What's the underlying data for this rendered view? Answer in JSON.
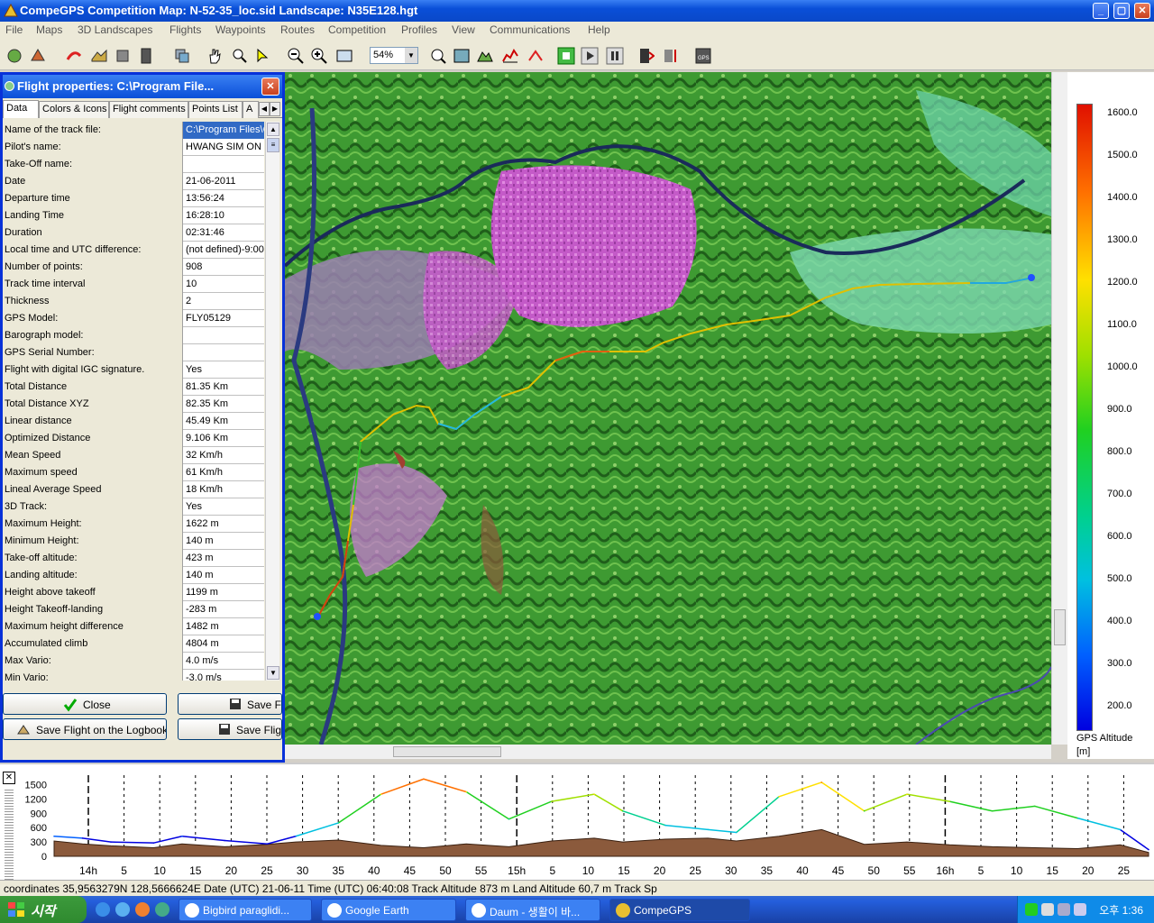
{
  "window": {
    "title": "CompeGPS Competition Map: N-52-35_loc.sid Landscape: N35E128.hgt"
  },
  "menu": [
    "File",
    "Maps",
    "3D Landscapes",
    "Flights",
    "Waypoints",
    "Routes",
    "Competition",
    "Profiles",
    "View",
    "Communications",
    "Help"
  ],
  "toolbar": {
    "zoom_value": "54%"
  },
  "dialog": {
    "title": "Flight properties: C:\\Program File...",
    "tabs": [
      "Data",
      "Colors & Icons",
      "Flight comments",
      "Points List",
      "A"
    ],
    "rows": [
      {
        "k": "Name of the track file:",
        "v": "C:\\Program Files\\C"
      },
      {
        "k": "Pilot's name:",
        "v": "HWANG SIM ON"
      },
      {
        "k": "Take-Off name:",
        "v": ""
      },
      {
        "k": "Date",
        "v": "21-06-2011"
      },
      {
        "k": "Departure time",
        "v": "13:56:24"
      },
      {
        "k": "Landing Time",
        "v": "16:28:10"
      },
      {
        "k": "Duration",
        "v": "02:31:46"
      },
      {
        "k": "Local time and UTC difference:",
        "v": "(not defined)-9:00"
      },
      {
        "k": "Number of points:",
        "v": "908"
      },
      {
        "k": "Track time interval",
        "v": "10"
      },
      {
        "k": "Thickness",
        "v": "2"
      },
      {
        "k": "GPS Model:",
        "v": "FLY05129"
      },
      {
        "k": "Barograph model:",
        "v": ""
      },
      {
        "k": "GPS Serial Number:",
        "v": ""
      },
      {
        "k": "Flight with digital IGC signature.",
        "v": "Yes"
      },
      {
        "k": "Total Distance",
        "v": "81.35 Km"
      },
      {
        "k": "Total Distance XYZ",
        "v": "82.35 Km"
      },
      {
        "k": "Linear distance",
        "v": "45.49 Km"
      },
      {
        "k": "Optimized Distance",
        "v": "9.106 Km"
      },
      {
        "k": "Mean Speed",
        "v": "32 Km/h"
      },
      {
        "k": "Maximum speed",
        "v": "61 Km/h"
      },
      {
        "k": "Lineal Average Speed",
        "v": "18 Km/h"
      },
      {
        "k": "3D Track:",
        "v": "Yes"
      },
      {
        "k": "Maximum Height:",
        "v": "1622 m"
      },
      {
        "k": "Minimum Height:",
        "v": "140 m"
      },
      {
        "k": "Take-off altitude:",
        "v": "423 m"
      },
      {
        "k": "Landing altitude:",
        "v": "140 m"
      },
      {
        "k": "Height above takeoff",
        "v": "1199 m"
      },
      {
        "k": "Height Takeoff-landing",
        "v": "-283 m"
      },
      {
        "k": "Maximum height difference",
        "v": "1482 m"
      },
      {
        "k": "Accumulated climb",
        "v": "4804 m"
      },
      {
        "k": "Max Vario:",
        "v": "4.0 m/s"
      },
      {
        "k": "Min Vario:",
        "v": "-3.0 m/s"
      }
    ],
    "buttons": {
      "close": "Close",
      "save_file": "Save Fli",
      "save_logbook": "Save Flight on the Logbook",
      "save_flight": "Save Flight"
    }
  },
  "legend": {
    "ticks": [
      "1600.0",
      "1500.0",
      "1400.0",
      "1300.0",
      "1200.0",
      "1100.0",
      "1000.0",
      "900.0",
      "800.0",
      "700.0",
      "600.0",
      "500.0",
      "400.0",
      "300.0",
      "200.0"
    ],
    "title_line1": "GPS Altitude",
    "title_line2": "[m]"
  },
  "chart_data": {
    "type": "area",
    "ylabel": "",
    "ylim": [
      0,
      1700
    ],
    "yticks": [
      "1500",
      "1200",
      "900",
      "600",
      "300",
      "0"
    ],
    "xticks": [
      "14h",
      "5",
      "10",
      "15",
      "20",
      "25",
      "30",
      "35",
      "40",
      "45",
      "50",
      "55",
      "15h",
      "5",
      "10",
      "15",
      "20",
      "25",
      "30",
      "35",
      "40",
      "45",
      "50",
      "55",
      "16h",
      "5",
      "10",
      "15",
      "20",
      "25"
    ],
    "series": [
      {
        "x": [
          0,
          4,
          8,
          14,
          18,
          24,
          30,
          34,
          40,
          46,
          52,
          58,
          64,
          70,
          76,
          80,
          86,
          92,
          96,
          102,
          108,
          114,
          120,
          126,
          132,
          138,
          144,
          150,
          154
        ],
        "values": [
          420,
          380,
          300,
          280,
          420,
          330,
          260,
          420,
          700,
          1300,
          1620,
          1350,
          780,
          1150,
          1300,
          950,
          650,
          560,
          500,
          1250,
          1550,
          950,
          1300,
          1150,
          950,
          1050,
          800,
          560,
          140
        ]
      },
      {
        "x": [
          0,
          4,
          8,
          14,
          18,
          24,
          30,
          34,
          40,
          46,
          52,
          58,
          64,
          70,
          76,
          80,
          86,
          92,
          96,
          102,
          108,
          114,
          120,
          126,
          132,
          138,
          144,
          150,
          154
        ],
        "values": [
          320,
          260,
          220,
          180,
          260,
          200,
          250,
          300,
          340,
          230,
          180,
          260,
          200,
          320,
          380,
          300,
          360,
          380,
          320,
          420,
          560,
          250,
          300,
          240,
          200,
          180,
          160,
          240,
          80
        ]
      }
    ]
  },
  "status": {
    "text": "coordinates 35,9563279N 128,5666624E Date (UTC) 21-06-11 Time (UTC) 06:40:08 Track Altitude 873 m Land Altitude 60,7 m Track Sp"
  },
  "taskbar": {
    "start": "시작",
    "tasks": [
      "Bigbird paraglidi...",
      "Google Earth",
      "Daum - 생활이 바...",
      "CompeGPS"
    ],
    "clock": "오후 1:36"
  }
}
